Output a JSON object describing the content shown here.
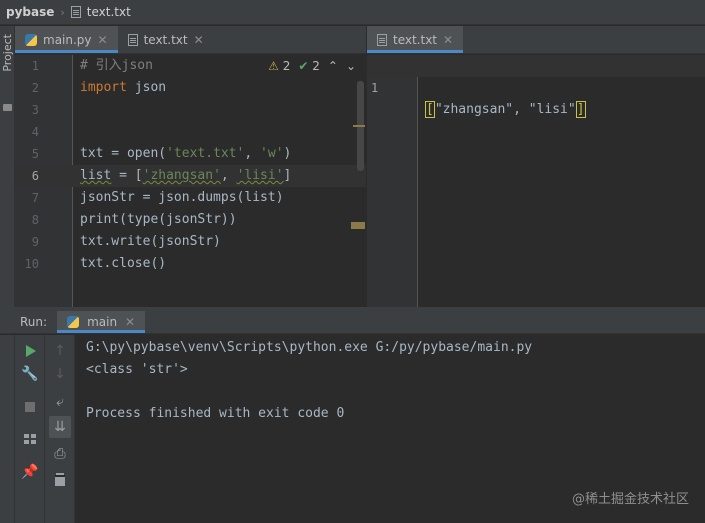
{
  "breadcrumb": {
    "project": "pybase",
    "file": "text.txt"
  },
  "left_strip": {
    "label": "Project"
  },
  "editor_left": {
    "tabs": [
      {
        "label": "main.py",
        "icon": "python-file-icon",
        "active": true
      },
      {
        "label": "text.txt",
        "icon": "text-file-icon",
        "active": false
      }
    ],
    "inspections": {
      "warnings": "2",
      "weak_warnings": "2"
    },
    "lines": [
      {
        "num": "1",
        "tokens": [
          {
            "t": "# 引入json",
            "c": "cm"
          }
        ]
      },
      {
        "num": "2",
        "tokens": [
          {
            "t": "import",
            "c": "kw"
          },
          {
            "t": " json",
            "c": "plain"
          }
        ]
      },
      {
        "num": "3",
        "tokens": []
      },
      {
        "num": "4",
        "tokens": []
      },
      {
        "num": "5",
        "tokens": [
          {
            "t": "txt = ",
            "c": "plain"
          },
          {
            "t": "open",
            "c": "fn"
          },
          {
            "t": "(",
            "c": "plain"
          },
          {
            "t": "'text.txt'",
            "c": "str"
          },
          {
            "t": ", ",
            "c": "plain"
          },
          {
            "t": "'w'",
            "c": "str"
          },
          {
            "t": ")",
            "c": "plain"
          }
        ]
      },
      {
        "num": "6",
        "current": true,
        "tokens": [
          {
            "t": "list",
            "c": "plain wavy"
          },
          {
            "t": " = [",
            "c": "plain"
          },
          {
            "t": "'zhangsan'",
            "c": "str wavy"
          },
          {
            "t": ", ",
            "c": "plain"
          },
          {
            "t": "'lisi'",
            "c": "str wavy"
          },
          {
            "t": "]",
            "c": "plain"
          }
        ]
      },
      {
        "num": "7",
        "tokens": [
          {
            "t": "jsonStr = json.dumps(",
            "c": "plain"
          },
          {
            "t": "list",
            "c": "plain"
          },
          {
            "t": ")",
            "c": "plain"
          }
        ]
      },
      {
        "num": "8",
        "tokens": [
          {
            "t": "print",
            "c": "fn"
          },
          {
            "t": "(",
            "c": "plain"
          },
          {
            "t": "type",
            "c": "fn"
          },
          {
            "t": "(jsonStr))",
            "c": "plain"
          }
        ]
      },
      {
        "num": "9",
        "tokens": [
          {
            "t": "txt.write(jsonStr)",
            "c": "plain"
          }
        ]
      },
      {
        "num": "10",
        "tokens": [
          {
            "t": "txt.close()",
            "c": "plain"
          }
        ]
      }
    ]
  },
  "editor_right": {
    "tab": {
      "label": "text.txt",
      "icon": "text-file-icon"
    },
    "line_num": "1",
    "content_open": "[",
    "content_body": "\"zhangsan\", \"lisi\"",
    "content_close": "]"
  },
  "run_panel": {
    "label": "Run:",
    "tab_label": "main",
    "output": [
      "G:\\py\\pybase\\venv\\Scripts\\python.exe G:/py/pybase/main.py",
      "<class 'str'>",
      "",
      "Process finished with exit code 0"
    ]
  },
  "watermark": "@稀土掘金技术社区",
  "colors": {
    "accent": "#4a88c7",
    "run_green": "#59a869",
    "keyword": "#cc7832",
    "string": "#6a8759"
  }
}
